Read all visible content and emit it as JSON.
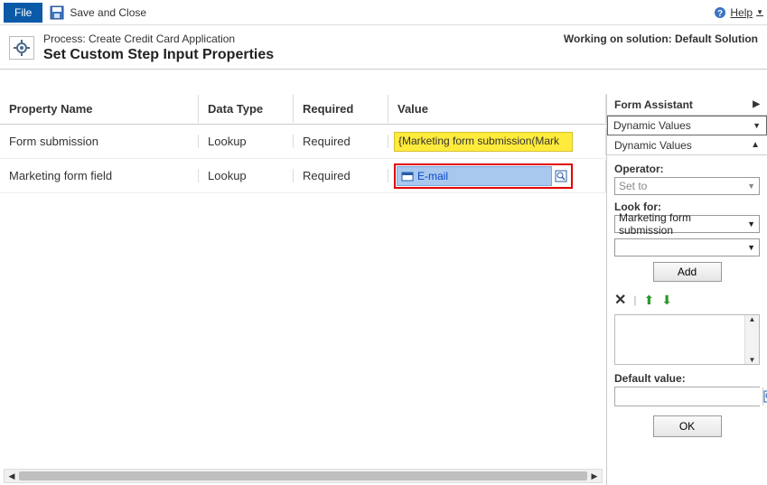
{
  "toolbar": {
    "file": "File",
    "save_close": "Save and Close",
    "help": "Help"
  },
  "header": {
    "process": "Process: Create Credit Card Application",
    "title": "Set Custom Step Input Properties",
    "working_on": "Working on solution: Default Solution"
  },
  "grid": {
    "columns": {
      "name": "Property Name",
      "datatype": "Data Type",
      "required": "Required",
      "value": "Value"
    },
    "rows": [
      {
        "name": "Form submission",
        "datatype": "Lookup",
        "required": "Required",
        "value": "{Marketing form submission(Mark"
      },
      {
        "name": "Marketing form field",
        "datatype": "Lookup",
        "required": "Required",
        "value": "E-mail"
      }
    ]
  },
  "form_assistant": {
    "title": "Form Assistant",
    "dropdown": "Dynamic Values",
    "section": "Dynamic Values",
    "operator_label": "Operator:",
    "operator_value": "Set to",
    "lookfor_label": "Look for:",
    "lookfor_value": "Marketing form submission",
    "add": "Add",
    "default_label": "Default value:",
    "ok": "OK"
  }
}
